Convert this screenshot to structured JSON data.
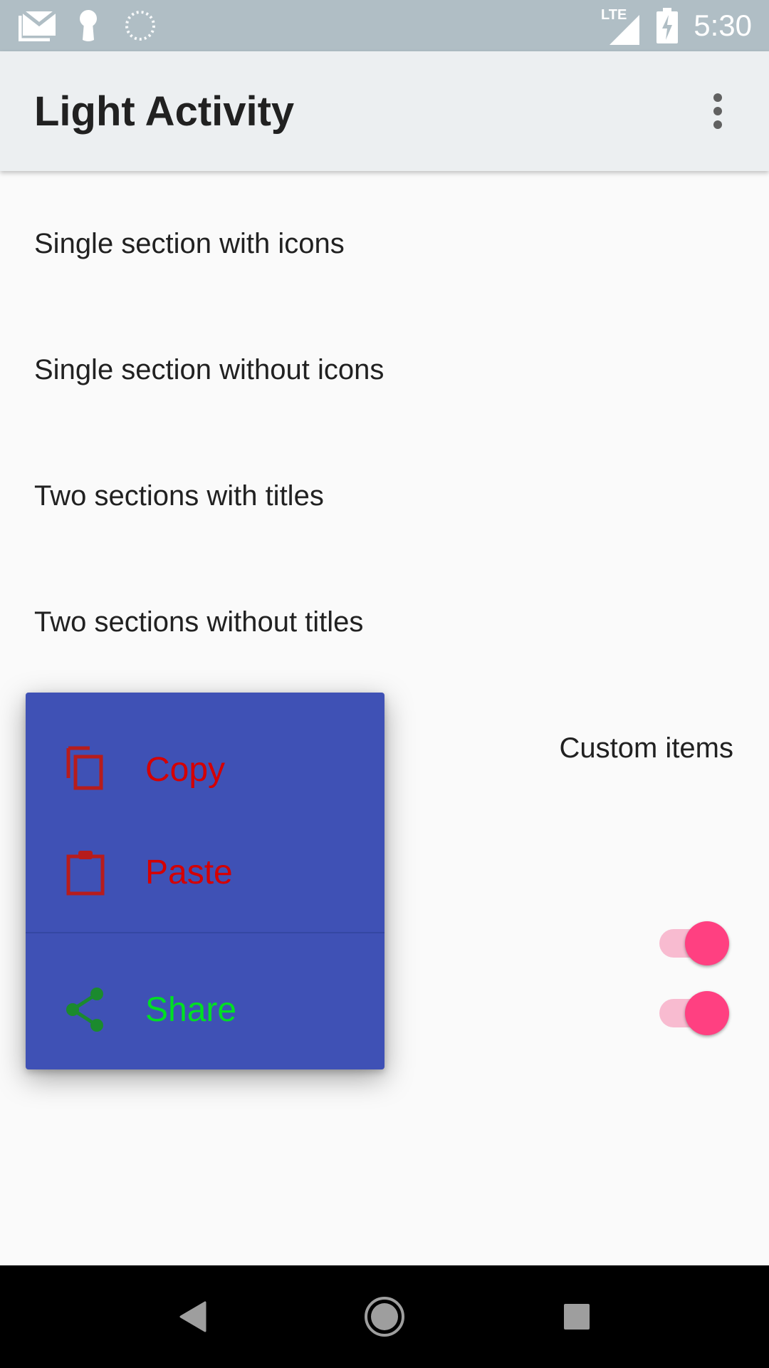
{
  "status_bar": {
    "time": "5:30",
    "network": "LTE",
    "icons": [
      "gmail-icon",
      "key-icon",
      "sync-icon",
      "lte-signal-icon",
      "battery-charging-icon"
    ]
  },
  "app_bar": {
    "title": "Light Activity",
    "overflow_icon": "more-vert-icon"
  },
  "list": {
    "items": [
      {
        "label": "Single section with icons"
      },
      {
        "label": "Single section without icons"
      },
      {
        "label": "Two sections with titles"
      },
      {
        "label": "Two sections without titles"
      },
      {
        "label": "Custom items"
      }
    ],
    "switches": [
      {
        "checked": true
      },
      {
        "checked": true
      }
    ]
  },
  "popup_menu": {
    "background": "#3f51b5",
    "sections": [
      {
        "items": [
          {
            "label": "Copy",
            "icon": "copy-icon",
            "color": "#d50000",
            "icon_color": "#b71c1c"
          },
          {
            "label": "Paste",
            "icon": "clipboard-icon",
            "color": "#d50000",
            "icon_color": "#b71c1c"
          }
        ]
      },
      {
        "items": [
          {
            "label": "Share",
            "icon": "share-icon",
            "color": "#00e023",
            "icon_color": "#1b8a2e"
          }
        ]
      }
    ]
  },
  "colors": {
    "status_bar": "#b0bec5",
    "app_bar": "#eceff1",
    "accent": "#ff4081",
    "accent_track": "#f8bbd0"
  },
  "nav_bar": {
    "icons": [
      "back-icon",
      "home-icon",
      "recents-icon"
    ]
  }
}
